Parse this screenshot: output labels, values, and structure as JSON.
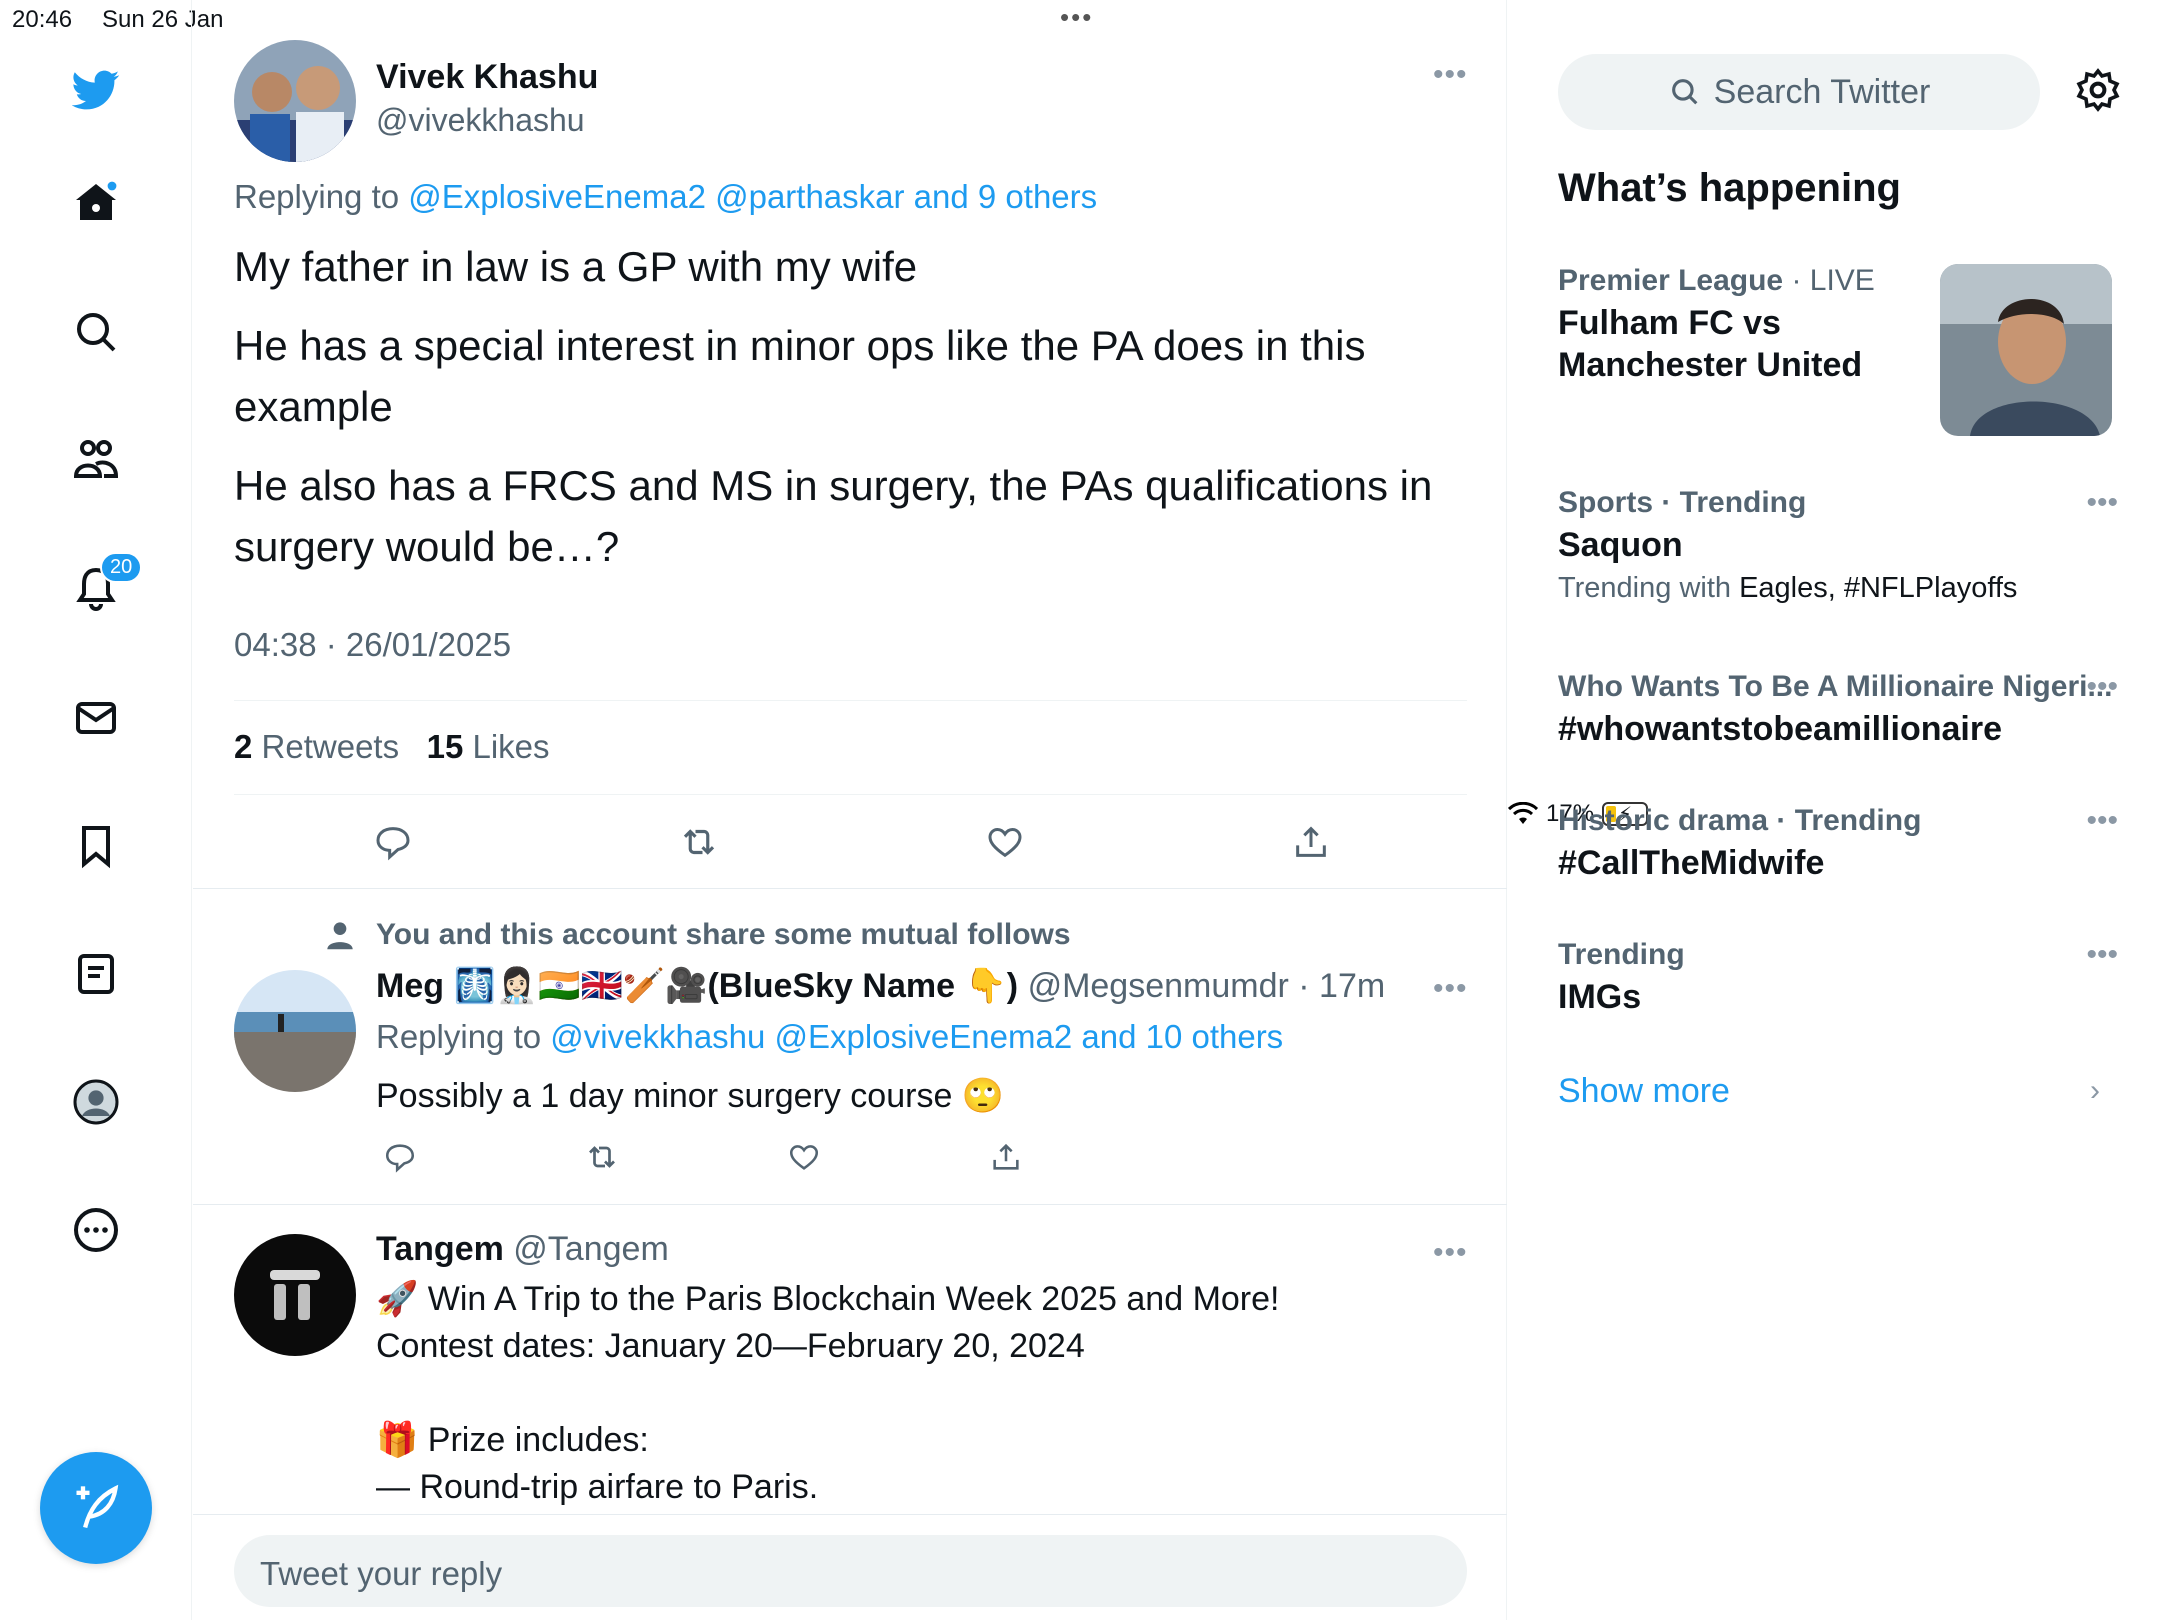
{
  "status_bar": {
    "time": "20:46",
    "date": "Sun 26 Jan",
    "battery": "17%"
  },
  "nav": {
    "notifications_count": "20"
  },
  "tweet": {
    "name": "Vivek Khashu",
    "handle": "@vivekkhashu",
    "replying_prefix": "Replying to",
    "replying_to": "@ExplosiveEnema2 @parthaskar and 9 others",
    "paragraphs": [
      "My father in law is a GP with my wife",
      "He has a special interest in minor ops like the PA does in this example",
      "He also has a FRCS and MS in surgery, the PAs qualifications in surgery would be…?"
    ],
    "timestamp": "04:38 · 26/01/2025",
    "retweets_count": "2",
    "retweets_label": "Retweets",
    "likes_count": "15",
    "likes_label": "Likes"
  },
  "reply1": {
    "mutual_text": "You and this account share some mutual follows",
    "name": "Meg 🩻👩🏻‍⚕️🇮🇳🇬🇧🏏🎥(BlueSky Name 👇)",
    "handle_time": "@Megsenmumdr · 17m",
    "replying_prefix": "Replying to",
    "replying_to": "@vivekkhashu @ExplosiveEnema2 and 10 others",
    "text": "Possibly a 1 day minor surgery course 🙄"
  },
  "reply2": {
    "name": "Tangem",
    "handle": "@Tangem",
    "text": "🚀 Win A Trip to the Paris Blockchain Week 2025 and More!\nContest dates: January 20—February 20, 2024\n\n🎁 Prize includes:\n— Round-trip airfare to Paris."
  },
  "reply_box": {
    "placeholder": "Tweet your reply"
  },
  "sidebar": {
    "search_placeholder": "Search Twitter",
    "heading": "What’s happening",
    "trends": [
      {
        "category": "Premier League",
        "suffix": " · LIVE",
        "title": "Fulham FC vs Manchester United",
        "sub_prefix": "",
        "sub_value": ""
      },
      {
        "category": "Sports · Trending",
        "suffix": "",
        "title": "Saquon",
        "sub_prefix": "Trending with ",
        "sub_value": "Eagles, #NFLPlayoffs"
      },
      {
        "category": "Who Wants To Be A Millionaire Nigeri...",
        "suffix": "",
        "title": "#whowantstobeamillionaire",
        "sub_prefix": "",
        "sub_value": ""
      },
      {
        "category": "Historic drama · Trending",
        "suffix": "",
        "title": "#CallTheMidwife",
        "sub_prefix": "",
        "sub_value": ""
      },
      {
        "category": "Trending",
        "suffix": "",
        "title": "IMGs",
        "sub_prefix": "",
        "sub_value": ""
      }
    ],
    "show_more": "Show more"
  },
  "colors": {
    "accent": "#1d9bf0",
    "text": "#0f1419",
    "secondary": "#536471"
  }
}
